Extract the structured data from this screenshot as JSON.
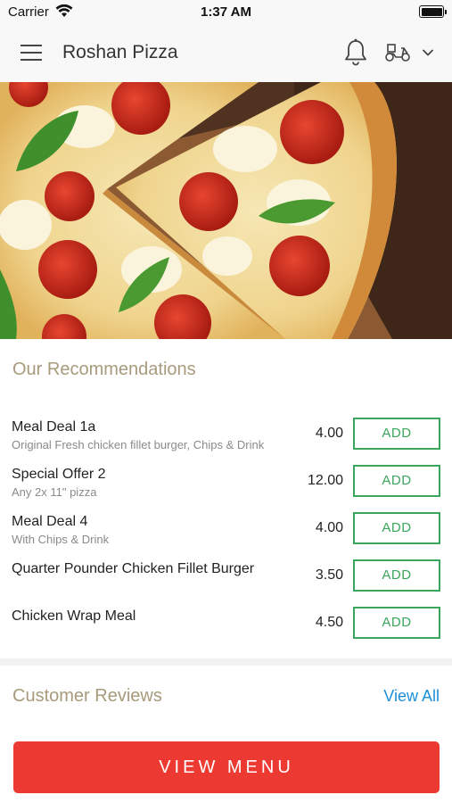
{
  "status_bar": {
    "carrier": "Carrier",
    "time": "1:37 AM"
  },
  "header": {
    "title": "Roshan Pizza"
  },
  "recommendations": {
    "title": "Our Recommendations",
    "items": [
      {
        "name": "Meal Deal 1a",
        "description": "Original Fresh chicken fillet burger, Chips & Drink",
        "price": "4.00",
        "button": "ADD"
      },
      {
        "name": "Special Offer 2",
        "description": "Any 2x 11\" pizza",
        "price": "12.00",
        "button": "ADD"
      },
      {
        "name": "Meal Deal 4",
        "description": "With Chips & Drink",
        "price": "4.00",
        "button": "ADD"
      },
      {
        "name": "Quarter Pounder Chicken Fillet Burger",
        "description": "",
        "price": "3.50",
        "button": "ADD"
      },
      {
        "name": "Chicken Wrap Meal",
        "description": "",
        "price": "4.50",
        "button": "ADD"
      }
    ]
  },
  "reviews": {
    "title": "Customer Reviews",
    "view_all": "View All"
  },
  "cta": {
    "label": "VIEW MENU"
  },
  "colors": {
    "accent_green": "#3aa55c",
    "cta_red": "#ec3a33",
    "link_blue": "#1d8fd8",
    "section_title": "#a89a7c"
  }
}
